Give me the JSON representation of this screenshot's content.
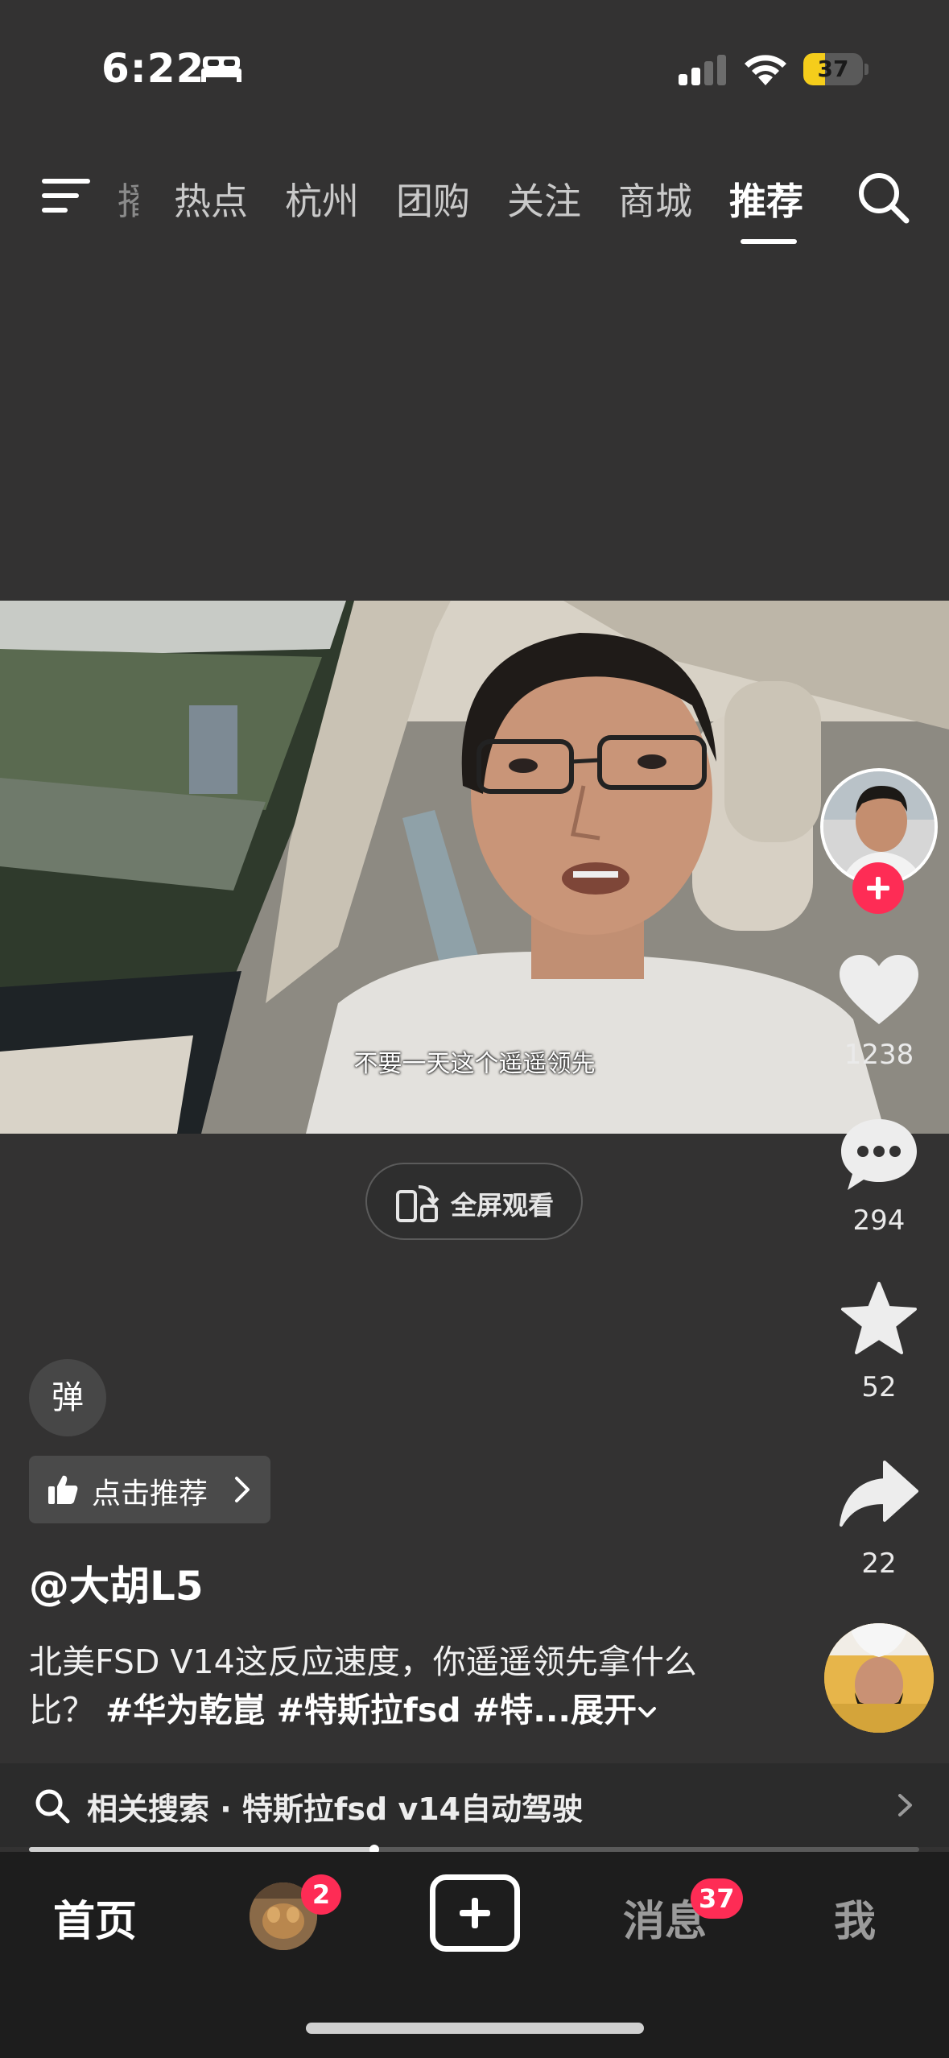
{
  "status_bar": {
    "time": "6:22",
    "battery": "37",
    "battery_fraction": 0.37,
    "icons": [
      "bed-icon",
      "cellular-signal-icon",
      "wifi-icon",
      "battery-icon"
    ]
  },
  "top_nav": {
    "partial_tab": "播",
    "tabs": [
      "热点",
      "杭州",
      "团购",
      "关注",
      "商城",
      "推荐"
    ],
    "active_tab": "推荐",
    "icons": [
      "menu-icon",
      "search-icon"
    ]
  },
  "video": {
    "subtitle": "不要一天这个遥遥领先",
    "fullscreen_label": "全屏观看"
  },
  "side_actions": {
    "likes": "1238",
    "comments": "294",
    "favorites": "52",
    "shares": "22",
    "icons": [
      "heart-icon",
      "comment-icon",
      "star-icon",
      "share-icon"
    ]
  },
  "info": {
    "danmu_label": "弹",
    "recommend_label": "点击推荐",
    "author": "@大胡L5",
    "description_text": "北美FSD V14这反应速度，你遥遥领先拿什么比？",
    "description_tags": "#华为乾崑 #特斯拉fsd #特...",
    "expand_label": "展开"
  },
  "related_search": {
    "label": "相关搜索 · 特斯拉fsd v14自动驾驶",
    "progress_fraction": 0.388
  },
  "bottom_nav": {
    "home": "首页",
    "friend_badge": "2",
    "messages": "消息",
    "messages_badge": "37",
    "me": "我"
  },
  "colors": {
    "background": "#333232",
    "accent_red": "#fe2c55",
    "battery_yellow": "#f5cd1b"
  }
}
